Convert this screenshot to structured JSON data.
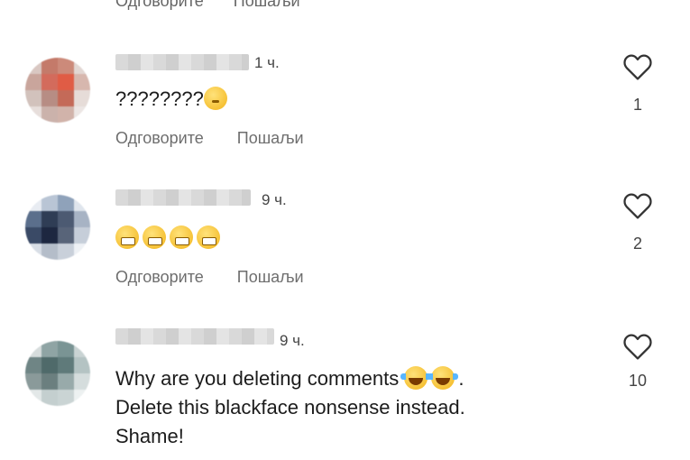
{
  "top": {
    "reply_label": "Одговорите",
    "send_label": "Пошаљи"
  },
  "comments": [
    {
      "time": "1 ч.",
      "text": "????????",
      "emoji": [
        "thinking-face"
      ],
      "reply_label": "Одговорите",
      "send_label": "Пошаљи",
      "likes": "1",
      "avatar_colors": [
        "#d9c7c2",
        "#c47a6a",
        "#cc8a7a",
        "#e2d7d3",
        "#c9a59c",
        "#d36b5c",
        "#e05c45",
        "#d7b7ae",
        "#d2c2bc",
        "#b78d84",
        "#c46a58",
        "#e6dcd8",
        "#e7dedb",
        "#cbb2ab",
        "#d1b3aa",
        "#ece6e4"
      ]
    },
    {
      "time": "9 ч.",
      "text": "",
      "emoji": [
        "grimacing-face",
        "grimacing-face",
        "grimacing-face",
        "grimacing-face"
      ],
      "reply_label": "Одговорите",
      "send_label": "Пошаљи",
      "likes": "2",
      "avatar_colors": [
        "#e8ecf2",
        "#b9c5d5",
        "#8fa2ba",
        "#dfe5ed",
        "#5b6f8c",
        "#2f3d55",
        "#4c5a72",
        "#a7b3c4",
        "#3a4a66",
        "#1d2740",
        "#586479",
        "#c6ced9",
        "#d8dee6",
        "#b4bdc9",
        "#c9d0da",
        "#eef1f5"
      ]
    },
    {
      "time": "9 ч.",
      "text": "Why are you deleting comments",
      "text_after": ".",
      "text_line2": "Delete this blackface nonsense instead.",
      "text_line3": "Shame!",
      "emoji": [
        "face-with-tears-of-joy",
        "face-with-tears-of-joy"
      ],
      "likes": "10",
      "avatar_colors": [
        "#d6dcdc",
        "#8fa4a4",
        "#7a9494",
        "#c9d3d3",
        "#6f8585",
        "#4f6a6a",
        "#5f7a7a",
        "#b4c3c3",
        "#8a9a9a",
        "#6b7f7f",
        "#98aaaa",
        "#d5dddd",
        "#e3e8e8",
        "#c4cfcf",
        "#cad4d4",
        "#edf1f1"
      ]
    }
  ]
}
